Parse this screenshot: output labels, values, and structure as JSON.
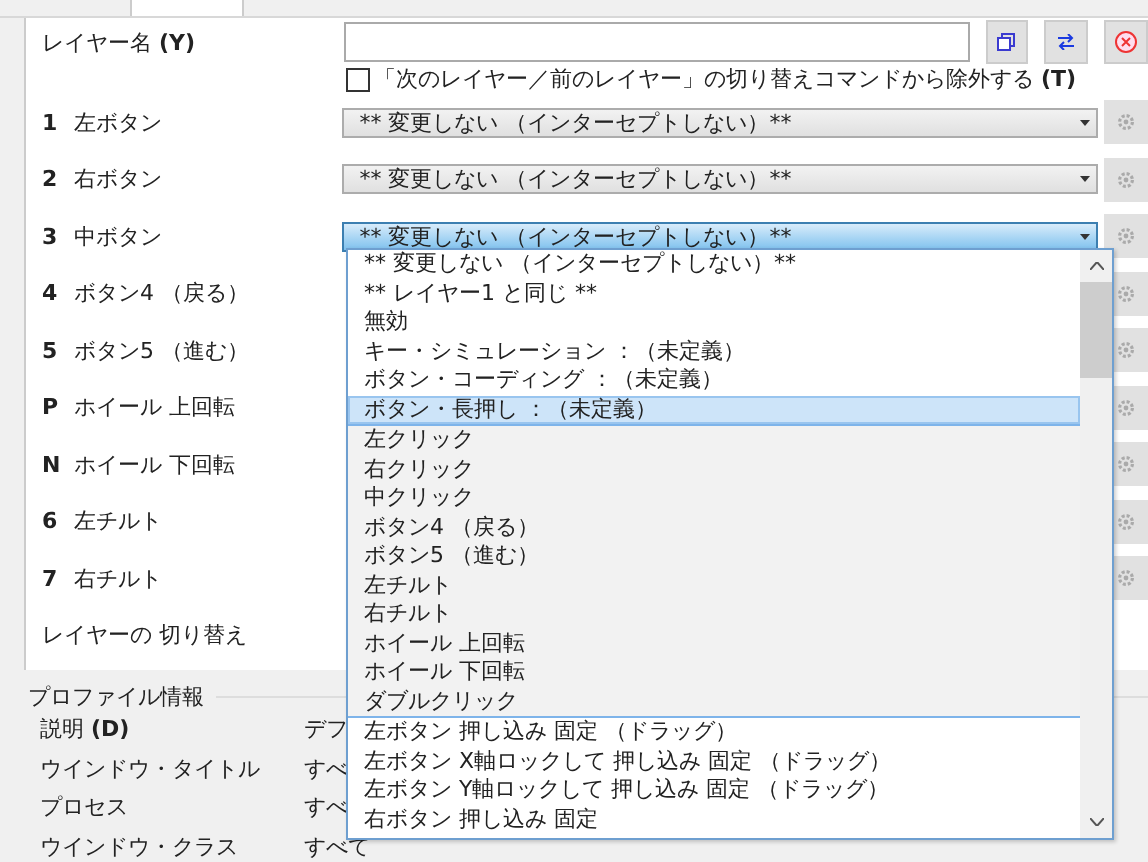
{
  "layer_name": {
    "label": "レイヤー名",
    "key": "(Y)"
  },
  "exclude_checkbox": {
    "label": "「次のレイヤー／前のレイヤー」の切り替えコマンドから除外する",
    "key": "(T)",
    "checked": false
  },
  "rows": [
    {
      "key": "1",
      "label": "左ボタン",
      "value": "** 変更しない （インターセプトしない）**",
      "open": false,
      "gear": true
    },
    {
      "key": "2",
      "label": "右ボタン",
      "value": "** 変更しない （インターセプトしない）**",
      "open": false,
      "gear": true
    },
    {
      "key": "3",
      "label": "中ボタン",
      "value": "** 変更しない （インターセプトしない）**",
      "open": true,
      "gear": true
    },
    {
      "key": "4",
      "label": "ボタン4 （戻る）",
      "gear": true
    },
    {
      "key": "5",
      "label": "ボタン5 （進む）",
      "gear": true
    },
    {
      "key": "P",
      "label": "ホイール 上回転",
      "gear": true
    },
    {
      "key": "N",
      "label": "ホイール 下回転",
      "gear": true
    },
    {
      "key": "6",
      "label": "左チルト",
      "gear": true
    },
    {
      "key": "7",
      "label": "右チルト",
      "gear": true
    },
    {
      "label": "レイヤーの 切り替え",
      "gear": false
    }
  ],
  "dropdown": {
    "option_groups": [
      {
        "kind": "plain",
        "options": [
          {
            "label": "** 変更しない （インターセプトしない）**",
            "selected": false
          },
          {
            "label": "** レイヤー1 と同じ **",
            "selected": false
          },
          {
            "label": "無効",
            "selected": false
          },
          {
            "label": "キー・シミュレーション ：（未定義）",
            "selected": false
          },
          {
            "label": "ボタン・コーディング ：（未定義）",
            "selected": false
          },
          {
            "label": "ボタン・長押し ：（未定義）",
            "selected": true
          }
        ]
      },
      {
        "kind": "shaded",
        "options": [
          {
            "label": "左クリック",
            "selected": false
          },
          {
            "label": "右クリック",
            "selected": false
          },
          {
            "label": "中クリック",
            "selected": false
          },
          {
            "label": "ボタン4 （戻る）",
            "selected": false
          },
          {
            "label": "ボタン5 （進む）",
            "selected": false
          },
          {
            "label": "左チルト",
            "selected": false
          },
          {
            "label": "右チルト",
            "selected": false
          },
          {
            "label": "ホイール 上回転",
            "selected": false
          },
          {
            "label": "ホイール 下回転",
            "selected": false
          },
          {
            "label": "ダブルクリック",
            "selected": false
          }
        ]
      },
      {
        "kind": "plain",
        "options": [
          {
            "label": "左ボタン 押し込み 固定 （ドラッグ）",
            "selected": false
          },
          {
            "label": "左ボタン X軸ロックして 押し込み 固定 （ドラッグ）",
            "selected": false
          },
          {
            "label": "左ボタン Y軸ロックして 押し込み 固定 （ドラッグ）",
            "selected": false
          },
          {
            "label": "右ボタン 押し込み 固定",
            "selected": false
          }
        ]
      }
    ]
  },
  "profile": {
    "title": "プロファイル情報",
    "rows": [
      {
        "label": "説明",
        "key": "(D)",
        "value": "デフ"
      },
      {
        "label": "ウインドウ・タイトル",
        "value": "すべ"
      },
      {
        "label": "プロセス",
        "value": "すべ"
      },
      {
        "label": "ウインドウ・クラス",
        "value": "すべて"
      }
    ]
  }
}
